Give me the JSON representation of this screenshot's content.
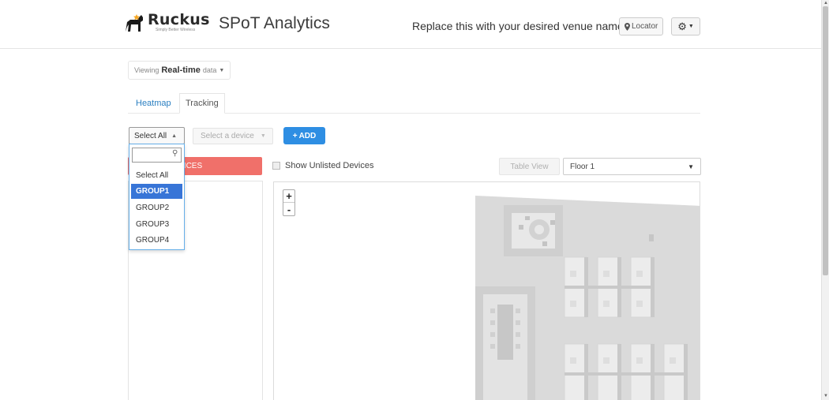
{
  "header": {
    "brand": "Ruckus",
    "tagline": "Simply Better Wireless",
    "app_title": "SPoT Analytics",
    "venue_name": "Replace this with your desired venue name",
    "locator_icon": "map-marker-icon",
    "locator_label": "Locator",
    "settings_icon": "gear-icon"
  },
  "viewing": {
    "prefix": "Viewing",
    "mode": "Real-time",
    "suffix": "data"
  },
  "tabs": [
    {
      "label": "Heatmap",
      "active": true
    },
    {
      "label": "Tracking",
      "active": false
    }
  ],
  "controls": {
    "group_select": {
      "value": "Select All",
      "open": true
    },
    "device_select_placeholder": "Select a device",
    "add_label": "ADD",
    "selected_devices_label": "LECTED DEVICES",
    "show_unlisted_label": "Show Unlisted Devices",
    "table_view_label": "Table View",
    "floor_select_value": "Floor 1"
  },
  "dropdown": {
    "search_value": "",
    "options": [
      {
        "label": "Select All",
        "selected": false
      },
      {
        "label": "GROUP1",
        "selected": true
      },
      {
        "label": "GROUP2",
        "selected": false
      },
      {
        "label": "GROUP3",
        "selected": false
      },
      {
        "label": "GROUP4",
        "selected": false
      }
    ]
  },
  "map": {
    "zoom_in": "+",
    "zoom_out": "-"
  },
  "colors": {
    "accent": "#2e8ee3",
    "danger": "#f0706a",
    "dropdown_selected": "#3875d7",
    "floorplan": "#dadada"
  }
}
